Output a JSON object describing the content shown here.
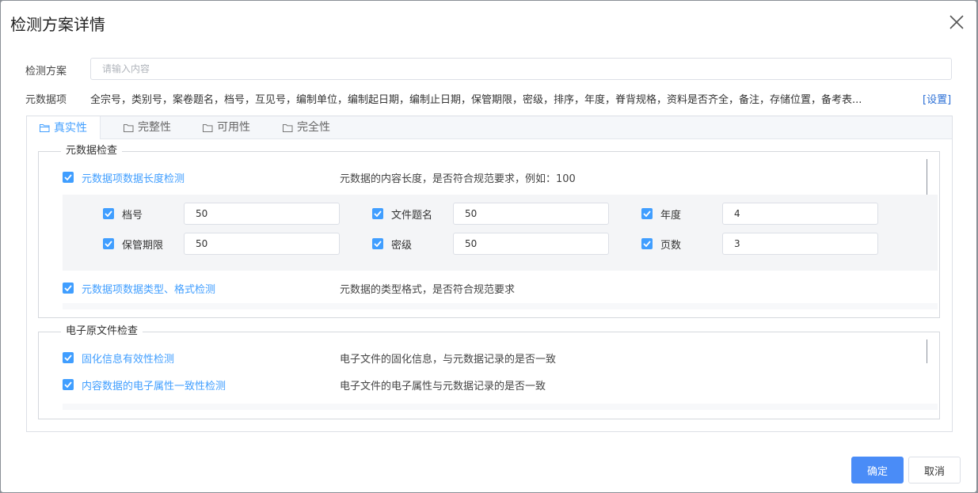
{
  "dialog": {
    "title": "检测方案详情",
    "scheme_label": "检测方案",
    "scheme_placeholder": "请输入内容",
    "scheme_value": "",
    "metadata_label": "元数据项",
    "metadata_items": "全宗号，类别号，案卷题名，档号，互见号，编制单位，编制起日期，编制止日期，保管期限，密级，排序，年度，脊背规格，资料是否齐全，备注，存储位置，备考表...",
    "metadata_set_link": "[设置]"
  },
  "tabs": [
    {
      "label": "真实性",
      "active": true
    },
    {
      "label": "完整性",
      "active": false
    },
    {
      "label": "可用性",
      "active": false
    },
    {
      "label": "完全性",
      "active": false
    }
  ],
  "metadata_check": {
    "legend": "元数据检查",
    "length_check": {
      "label": "元数据项数据长度检测",
      "checked": true,
      "description": "元数据的内容长度，是否符合规范要求，例如：100"
    },
    "fields": [
      {
        "label": "档号",
        "value": "50",
        "checked": true
      },
      {
        "label": "文件题名",
        "value": "50",
        "checked": true
      },
      {
        "label": "年度",
        "value": "4",
        "checked": true
      },
      {
        "label": "保管期限",
        "value": "50",
        "checked": true
      },
      {
        "label": "密级",
        "value": "50",
        "checked": true
      },
      {
        "label": "页数",
        "value": "3",
        "checked": true
      }
    ],
    "type_check": {
      "label": "元数据项数据类型、格式检测",
      "checked": true,
      "description": "元数据的类型格式，是否符合规范要求"
    }
  },
  "file_check": {
    "legend": "电子原文件检查",
    "items": [
      {
        "label": "固化信息有效性检测",
        "checked": true,
        "description": "电子文件的固化信息，与元数据记录的是否一致"
      },
      {
        "label": "内容数据的电子属性一致性检测",
        "checked": true,
        "description": "电子文件的电子属性与元数据记录的是否一致"
      }
    ]
  },
  "buttons": {
    "ok": "确定",
    "cancel": "取消"
  },
  "colors": {
    "accent": "#409eff",
    "primary_button": "#4a8cf7",
    "link": "#2b6fd6"
  }
}
